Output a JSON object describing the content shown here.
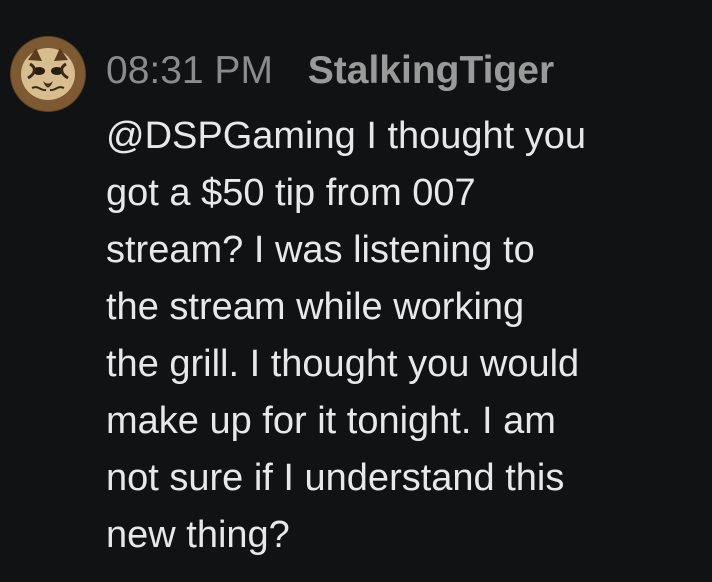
{
  "message": {
    "timestamp": "08:31 PM",
    "username": "StalkingTiger",
    "avatar_icon": "tiger-avatar-icon",
    "text_lines": [
      "@DSPGaming I thought you",
      "got a $50 tip from 007",
      "stream? I was listening to",
      "the stream while working",
      "the grill. I thought you would",
      "make up for it tonight. I am",
      "not sure if I understand this",
      "new thing?"
    ]
  },
  "colors": {
    "background": "#111213",
    "timestamp": "#8b8b8b",
    "username": "#9a9a9a",
    "message_text": "#e8e8e8"
  }
}
